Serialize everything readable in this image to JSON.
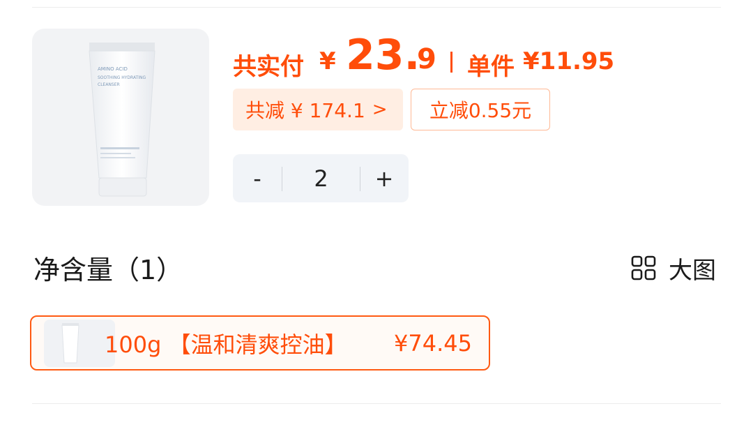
{
  "colors": {
    "accent": "#ff4d0a",
    "chip_bg": "#ffeee3",
    "stepper_bg": "#f1f4f8"
  },
  "product": {
    "image_name": "product-tube-image",
    "image_text": {
      "line1": "AMINO ACID",
      "line2": "SOOTHING HYDRATING",
      "line3": "CLEANSER"
    }
  },
  "price": {
    "total_label": "共实付",
    "currency": "¥",
    "total_int": "23.",
    "total_dec": "9",
    "unit_label": "单件",
    "unit_price": "¥11.95"
  },
  "discounts": {
    "total_reduction": "共减 ¥ 174.1",
    "chevron": ">",
    "instant_reduction": "立减0.55元"
  },
  "quantity": {
    "minus": "-",
    "value": "2",
    "plus": "+"
  },
  "spec": {
    "title": "净含量（1）",
    "view_toggle_label": "大图",
    "options": [
      {
        "label": "100g 【温和清爽控油】",
        "price": "¥74.45",
        "selected": true
      }
    ]
  }
}
